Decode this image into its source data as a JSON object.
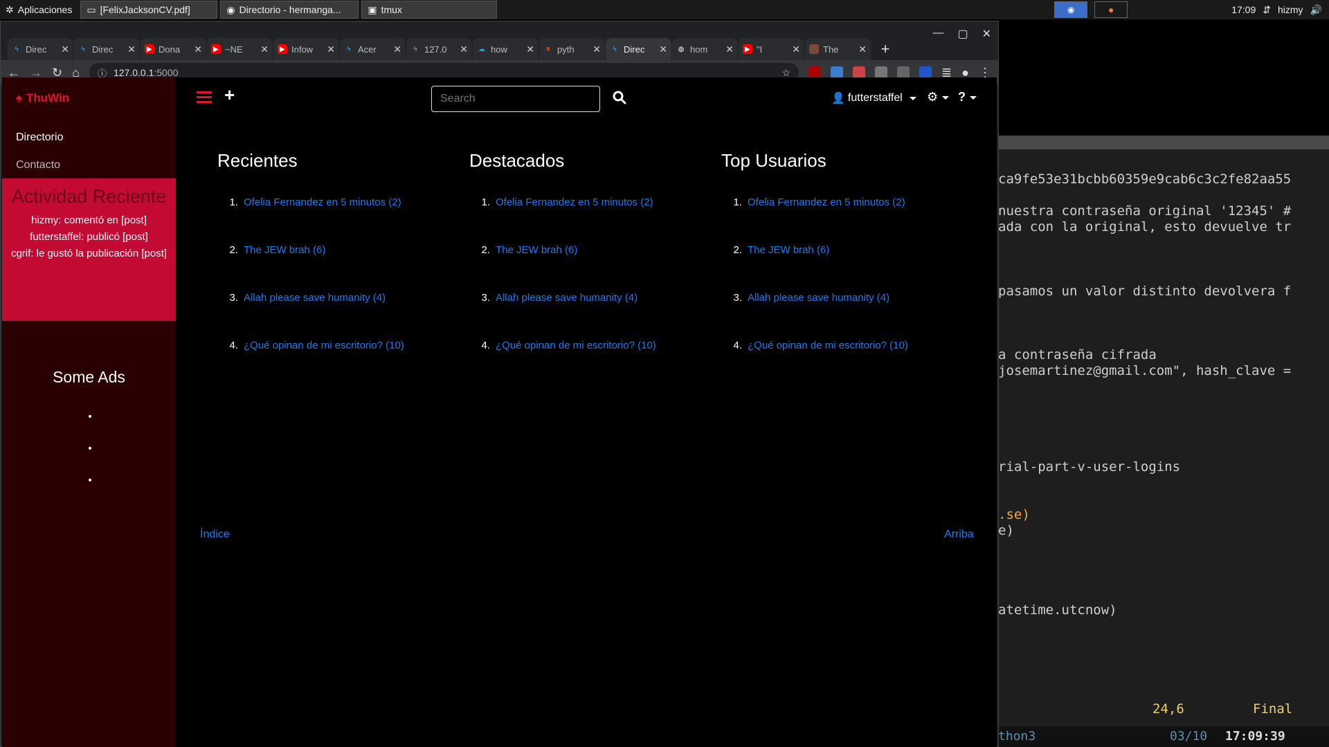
{
  "desktop": {
    "apps_label": "Aplicaciones",
    "taskbar": [
      "[FelixJacksonCV.pdf]",
      "Directorio - hermanga...",
      "tmux"
    ],
    "clock": "17:09",
    "user": "hizmy"
  },
  "browser": {
    "tabs": [
      {
        "title": "Direc"
      },
      {
        "title": "Direc"
      },
      {
        "title": "Dona"
      },
      {
        "title": "~NE"
      },
      {
        "title": "Infow"
      },
      {
        "title": "Acer"
      },
      {
        "title": "127.0"
      },
      {
        "title": "how"
      },
      {
        "title": "pyth"
      },
      {
        "title": "Direc"
      },
      {
        "title": "hom"
      },
      {
        "title": "\"I"
      },
      {
        "title": "The"
      }
    ],
    "url_host": "127.0.0.1",
    "url_port": ":5000"
  },
  "site": {
    "brand": "ThuWin",
    "nav": {
      "directorio": "Directorio",
      "contacto": "Contacto"
    },
    "activity_title": "Actividad Reciente",
    "activity": [
      "hizmy: comentó en [post]",
      "futterstaffel: publicó [post]",
      "cgrif: le gustó la publicación [post]"
    ],
    "ads_title": "Some Ads",
    "search_placeholder": "Search",
    "username": "futterstaffel",
    "columns": [
      {
        "title": "Recientes",
        "items": [
          "Ofelia Fernandez en 5 minutos (2)",
          "The JEW brah (6)",
          "Allah please save humanity (4)",
          "¿Qué opinan de mi escritorio? (10)"
        ]
      },
      {
        "title": "Destacados",
        "items": [
          "Ofelia Fernandez en 5 minutos (2)",
          "The JEW brah (6)",
          "Allah please save humanity (4)",
          "¿Qué opinan de mi escritorio? (10)"
        ]
      },
      {
        "title": "Top Usuarios",
        "items": [
          "Ofelia Fernandez en 5 minutos (2)",
          "The JEW brah (6)",
          "Allah please save humanity (4)",
          "¿Qué opinan de mi escritorio? (10)"
        ]
      }
    ],
    "footer_left": "Índice",
    "footer_right": "Arriba"
  },
  "terminal": {
    "lines": [
      "ca9fe53e31bcbb60359e9cab6c3c2fe82aa55",
      "nuestra contraseña original '12345' #",
      "ada con la original, esto devuelve tr",
      "pasamos un valor distinto devolvera f",
      "a contraseña cifrada",
      "josemartinez@gmail.com\", hash_clave =",
      "rial-part-v-user-logins",
      ".se)",
      "e)",
      "atetime.utcnow)"
    ],
    "position": "24,6",
    "mode": "Final",
    "bottom_left": "thon3",
    "bottom_mid": "03/10",
    "bottom_time": "17:09:39"
  }
}
